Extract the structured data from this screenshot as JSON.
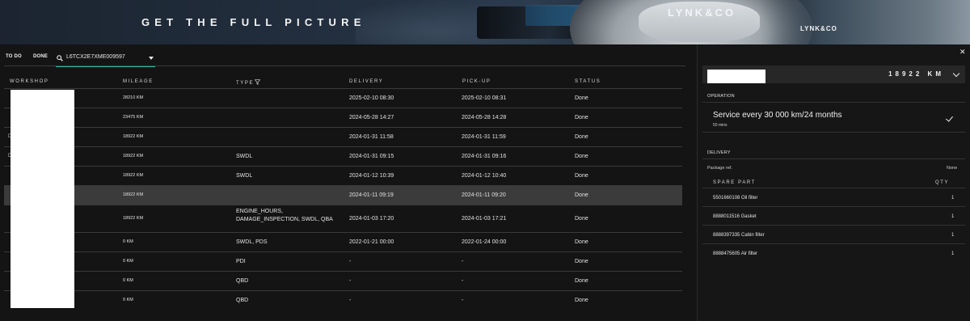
{
  "banner": {
    "headline": "GET THE FULL PICTURE",
    "brand_logo": "LYNK&CO",
    "brand_logo_small": "LYNK&CO"
  },
  "tabs": {
    "todo": "TO DO",
    "done": "DONE"
  },
  "search": {
    "icon": "search-icon",
    "value": "L6TCX2E7XME009597"
  },
  "table": {
    "headers": {
      "workshop": "WORKSHOP",
      "mileage": "MILEAGE",
      "type": "TYPE",
      "delivery": "DELIVERY",
      "pickup": "PICK-UP",
      "status": "STATUS"
    },
    "rows": [
      {
        "workshop_visible": "",
        "mileage": "28210 KM",
        "type": "",
        "delivery": "2025-02-10 08:30",
        "pickup": "2025-02-10 08:31",
        "status": "Done"
      },
      {
        "workshop_visible": "",
        "mileage": "23475 KM",
        "type": "",
        "delivery": "2024-05-28 14:27",
        "pickup": "2024-05-28 14:28",
        "status": "Done"
      },
      {
        "workshop_visible": "D",
        "mileage": "18922 KM",
        "type": "",
        "delivery": "2024-01-31 11:58",
        "pickup": "2024-01-31 11:59",
        "status": "Done"
      },
      {
        "workshop_visible": "D",
        "mileage": "18922 KM",
        "type": "SWDL",
        "delivery": "2024-01-31 09:15",
        "pickup": "2024-01-31 09:16",
        "status": "Done"
      },
      {
        "workshop_visible": "",
        "mileage": "18922 KM",
        "type": "SWDL",
        "delivery": "2024-01-12 10:39",
        "pickup": "2024-01-12 10:40",
        "status": "Done"
      },
      {
        "workshop_visible": "",
        "mileage": "18922 KM",
        "type": "",
        "delivery": "2024-01-11 09:19",
        "pickup": "2024-01-11 09:20",
        "status": "Done"
      },
      {
        "workshop_visible": "",
        "mileage": "18922 KM",
        "type": "ENGINE_HOURS, DAMAGE_INSPECTION, SWDL, QBA",
        "delivery": "2024-01-03 17:20",
        "pickup": "2024-01-03 17:21",
        "status": "Done"
      },
      {
        "workshop_visible": "",
        "mileage": "0 KM",
        "type": "SWDL, PDS",
        "delivery": "2022-01-21 00:00",
        "pickup": "2022-01-24 00:00",
        "status": "Done"
      },
      {
        "workshop_visible": "",
        "mileage": "0 KM",
        "type": "PDI",
        "delivery": "-",
        "pickup": "-",
        "status": "Done"
      },
      {
        "workshop_visible": "",
        "mileage": "0 KM",
        "type": "QBD",
        "delivery": "-",
        "pickup": "-",
        "status": "Done"
      },
      {
        "workshop_visible": "",
        "mileage": "0 KM",
        "type": "QBD",
        "delivery": "-",
        "pickup": "-",
        "status": "Done"
      }
    ]
  },
  "detail": {
    "close_icon": "close-icon",
    "mileage": "18922 KM",
    "operation_label": "OPERATION",
    "operation_title": "Service every 30 000 km/24 months",
    "operation_duration": "50 mins",
    "delivery_label": "DELIVERY",
    "package_ref_label": "Package ref.",
    "package_ref_value": "None",
    "spare_part_header": "SPARE PART",
    "qty_header": "QTY",
    "spare_parts": [
      {
        "part": "5501660108  Oil filter",
        "qty": "1"
      },
      {
        "part": "8888011516  Gasket",
        "qty": "1"
      },
      {
        "part": "8888397335  Cabin filter",
        "qty": "1"
      },
      {
        "part": "8888475605  Air filter",
        "qty": "1"
      }
    ]
  },
  "colors": {
    "accent": "#2cc1a5",
    "background": "#141414",
    "selected_row": "#3b3b3b"
  }
}
